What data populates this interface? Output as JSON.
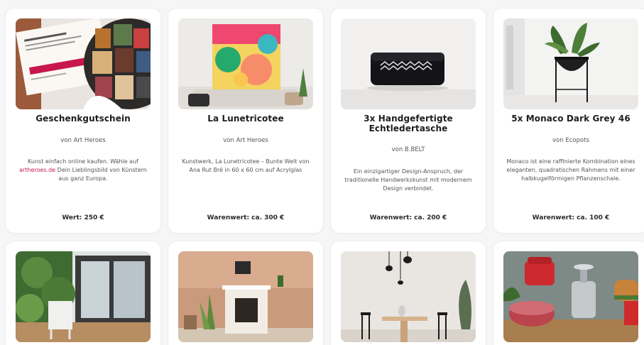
{
  "products": [
    {
      "title": "Geschenkgutschein",
      "vendor": "von Art Heroes",
      "description_parts": [
        "Kunst einfach online kaufen. Wähle auf ",
        "artheroes.de",
        " Dein Lieblingsbild von Künstern aus ganz Europa."
      ],
      "value": "Wert: 250 €"
    },
    {
      "title": "La Lunetricotee",
      "vendor": "von Art Heroes",
      "description": "Kunstwerk, La Lunetricotee – Bunte Welt von Ana Rut Bré in 60 x 60 cm auf Acrylglas",
      "value": "Warenwert: ca. 300 €"
    },
    {
      "title": "3x Handgefertigte Echtledertasche",
      "vendor": "von B.BELT",
      "description": "Ein einzigartiger Design-Anspruch, der traditionelle Handwerkskunst mit modernem Design verbindet.",
      "value": "Warenwert: ca. 200 €"
    },
    {
      "title": "5x Monaco Dark Grey 46",
      "vendor": "von Ecopots",
      "description": "Monaco ist eine raffinierte Kombination eines eleganten, quadratischen Rahmens mit einer halbkugelförmigen Pflanzenschale.",
      "value": "Warenwert: ca. 100 €"
    }
  ],
  "colors": {
    "background": "#f6f6f6",
    "card": "#ffffff",
    "link": "#c8174a"
  }
}
